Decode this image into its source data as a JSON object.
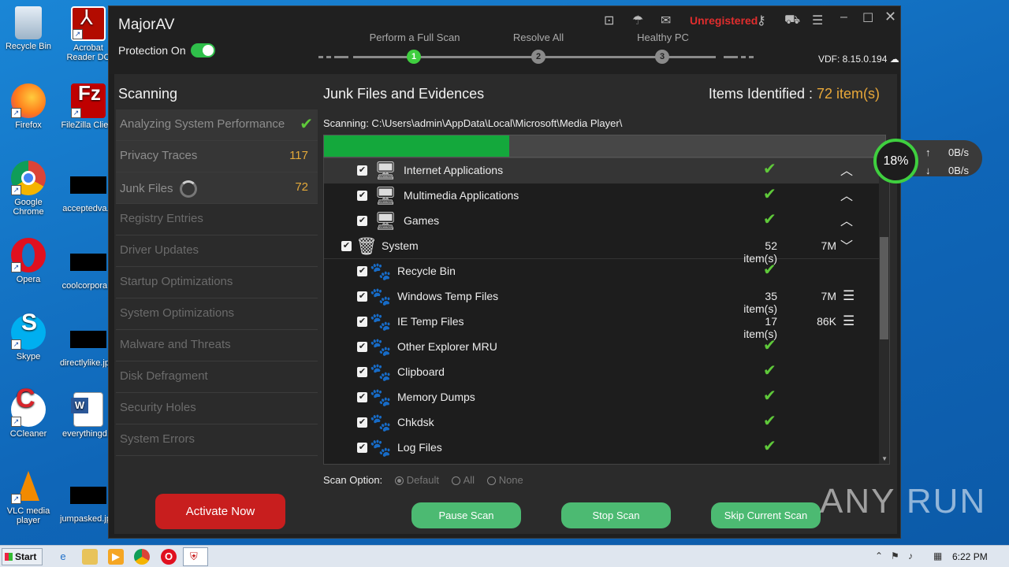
{
  "desktop": {
    "icons": [
      {
        "label": "Recycle Bin"
      },
      {
        "label": "Acrobat Reader DC"
      },
      {
        "label": "Firefox"
      },
      {
        "label": "FileZilla Client"
      },
      {
        "label": "Google Chrome"
      },
      {
        "label": "acceptedva..."
      },
      {
        "label": "Opera"
      },
      {
        "label": "coolcorpora..."
      },
      {
        "label": "Skype"
      },
      {
        "label": "directlylike.jp..."
      },
      {
        "label": "CCleaner"
      },
      {
        "label": "everythingd..."
      },
      {
        "label": "VLC media player"
      },
      {
        "label": "jumpasked.jp..."
      }
    ]
  },
  "app": {
    "title": "MajorAV",
    "protection_label": "Protection On",
    "unregistered": "Unregistered",
    "vdf": "VDF: 8.15.0.194",
    "steps": [
      {
        "label": "Perform a Full Scan",
        "num": "1"
      },
      {
        "label": "Resolve All",
        "num": "2"
      },
      {
        "label": "Healthy PC",
        "num": "3"
      }
    ]
  },
  "left": {
    "heading": "Scanning",
    "items": [
      {
        "label": "Analyzing System Performance",
        "value": ""
      },
      {
        "label": "Privacy Traces",
        "value": "117"
      },
      {
        "label": "Junk Files",
        "value": "72"
      },
      {
        "label": "Registry Entries",
        "value": ""
      },
      {
        "label": "Driver Updates",
        "value": ""
      },
      {
        "label": "Startup Optimizations",
        "value": ""
      },
      {
        "label": "System Optimizations",
        "value": ""
      },
      {
        "label": "Malware and Threats",
        "value": ""
      },
      {
        "label": "Disk Defragment",
        "value": ""
      },
      {
        "label": "Security Holes",
        "value": ""
      },
      {
        "label": "System Errors",
        "value": ""
      }
    ],
    "activate": "Activate Now"
  },
  "right": {
    "heading": "Junk Files and Evidences",
    "items_label": "Items Identified : ",
    "items_count": "72 item(s)",
    "scanning_path": "Scanning: C:\\Users\\admin\\AppData\\Local\\Microsoft\\Media Player\\",
    "progress": 0.33,
    "rows": [
      {
        "label": "Internet Applications",
        "count": "",
        "size": "",
        "ok": true
      },
      {
        "label": "Multimedia Applications",
        "count": "",
        "size": "",
        "ok": true
      },
      {
        "label": "Games",
        "count": "",
        "size": "",
        "ok": true
      },
      {
        "label": "System",
        "count": "52 item(s)",
        "size": "7M",
        "ok": false
      },
      {
        "label": "Recycle Bin",
        "count": "",
        "size": "",
        "ok": true
      },
      {
        "label": "Windows Temp Files",
        "count": "35 item(s)",
        "size": "7M",
        "ok": false
      },
      {
        "label": "IE Temp Files",
        "count": "17 item(s)",
        "size": "86K",
        "ok": false
      },
      {
        "label": "Other Explorer MRU",
        "count": "",
        "size": "",
        "ok": true
      },
      {
        "label": "Clipboard",
        "count": "",
        "size": "",
        "ok": true
      },
      {
        "label": "Memory Dumps",
        "count": "",
        "size": "",
        "ok": true
      },
      {
        "label": "Chkdsk",
        "count": "",
        "size": "",
        "ok": true
      },
      {
        "label": "Log Files",
        "count": "",
        "size": "",
        "ok": true
      }
    ],
    "scan_option_label": "Scan Option:",
    "scan_options": [
      "Default",
      "All",
      "None"
    ],
    "buttons": {
      "pause": "Pause Scan",
      "stop": "Stop Scan",
      "skip": "Skip Current Scan"
    }
  },
  "widget": {
    "percent": "18%",
    "up": "0B/s",
    "down": "0B/s"
  },
  "watermark": "ANY RUN",
  "taskbar": {
    "start": "Start",
    "time": "6:22 PM"
  }
}
